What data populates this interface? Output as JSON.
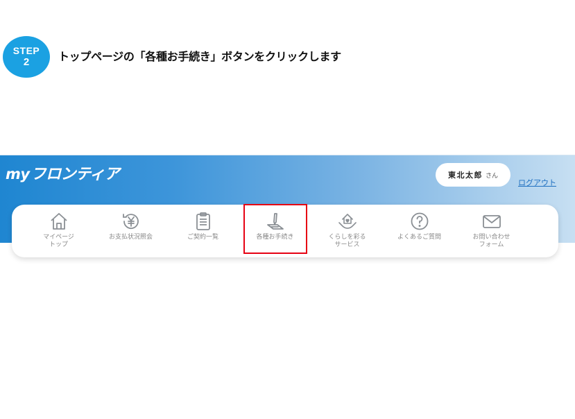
{
  "step": {
    "word": "STEP",
    "number": "2"
  },
  "instruction": "トップページの「各種お手続き」ボタンをクリックします",
  "header": {
    "logo_my": "my",
    "logo_text": "フロンティア",
    "user_name": "東北太郎",
    "user_suffix": "さん",
    "logout_label": "ログアウト"
  },
  "nav": {
    "items": [
      {
        "label": "マイページ\nトップ",
        "icon": "home-icon"
      },
      {
        "label": "お支払状況照会",
        "icon": "yen-history-icon"
      },
      {
        "label": "ご契約一覧",
        "icon": "clipboard-icon"
      },
      {
        "label": "各種お手続き",
        "icon": "pen-form-icon"
      },
      {
        "label": "くらしを彩る\nサービス",
        "icon": "house-hands-icon"
      },
      {
        "label": "よくあるご質問",
        "icon": "question-icon"
      },
      {
        "label": "お問い合わせ\nフォーム",
        "icon": "mail-icon"
      }
    ]
  },
  "colors": {
    "step_circle": "#1ba1e2",
    "highlight": "#e60012",
    "header_gradient_start": "#1f86d1",
    "header_gradient_end": "#c7dff2",
    "link": "#1e6fc0",
    "icon": "#8a8f94"
  }
}
